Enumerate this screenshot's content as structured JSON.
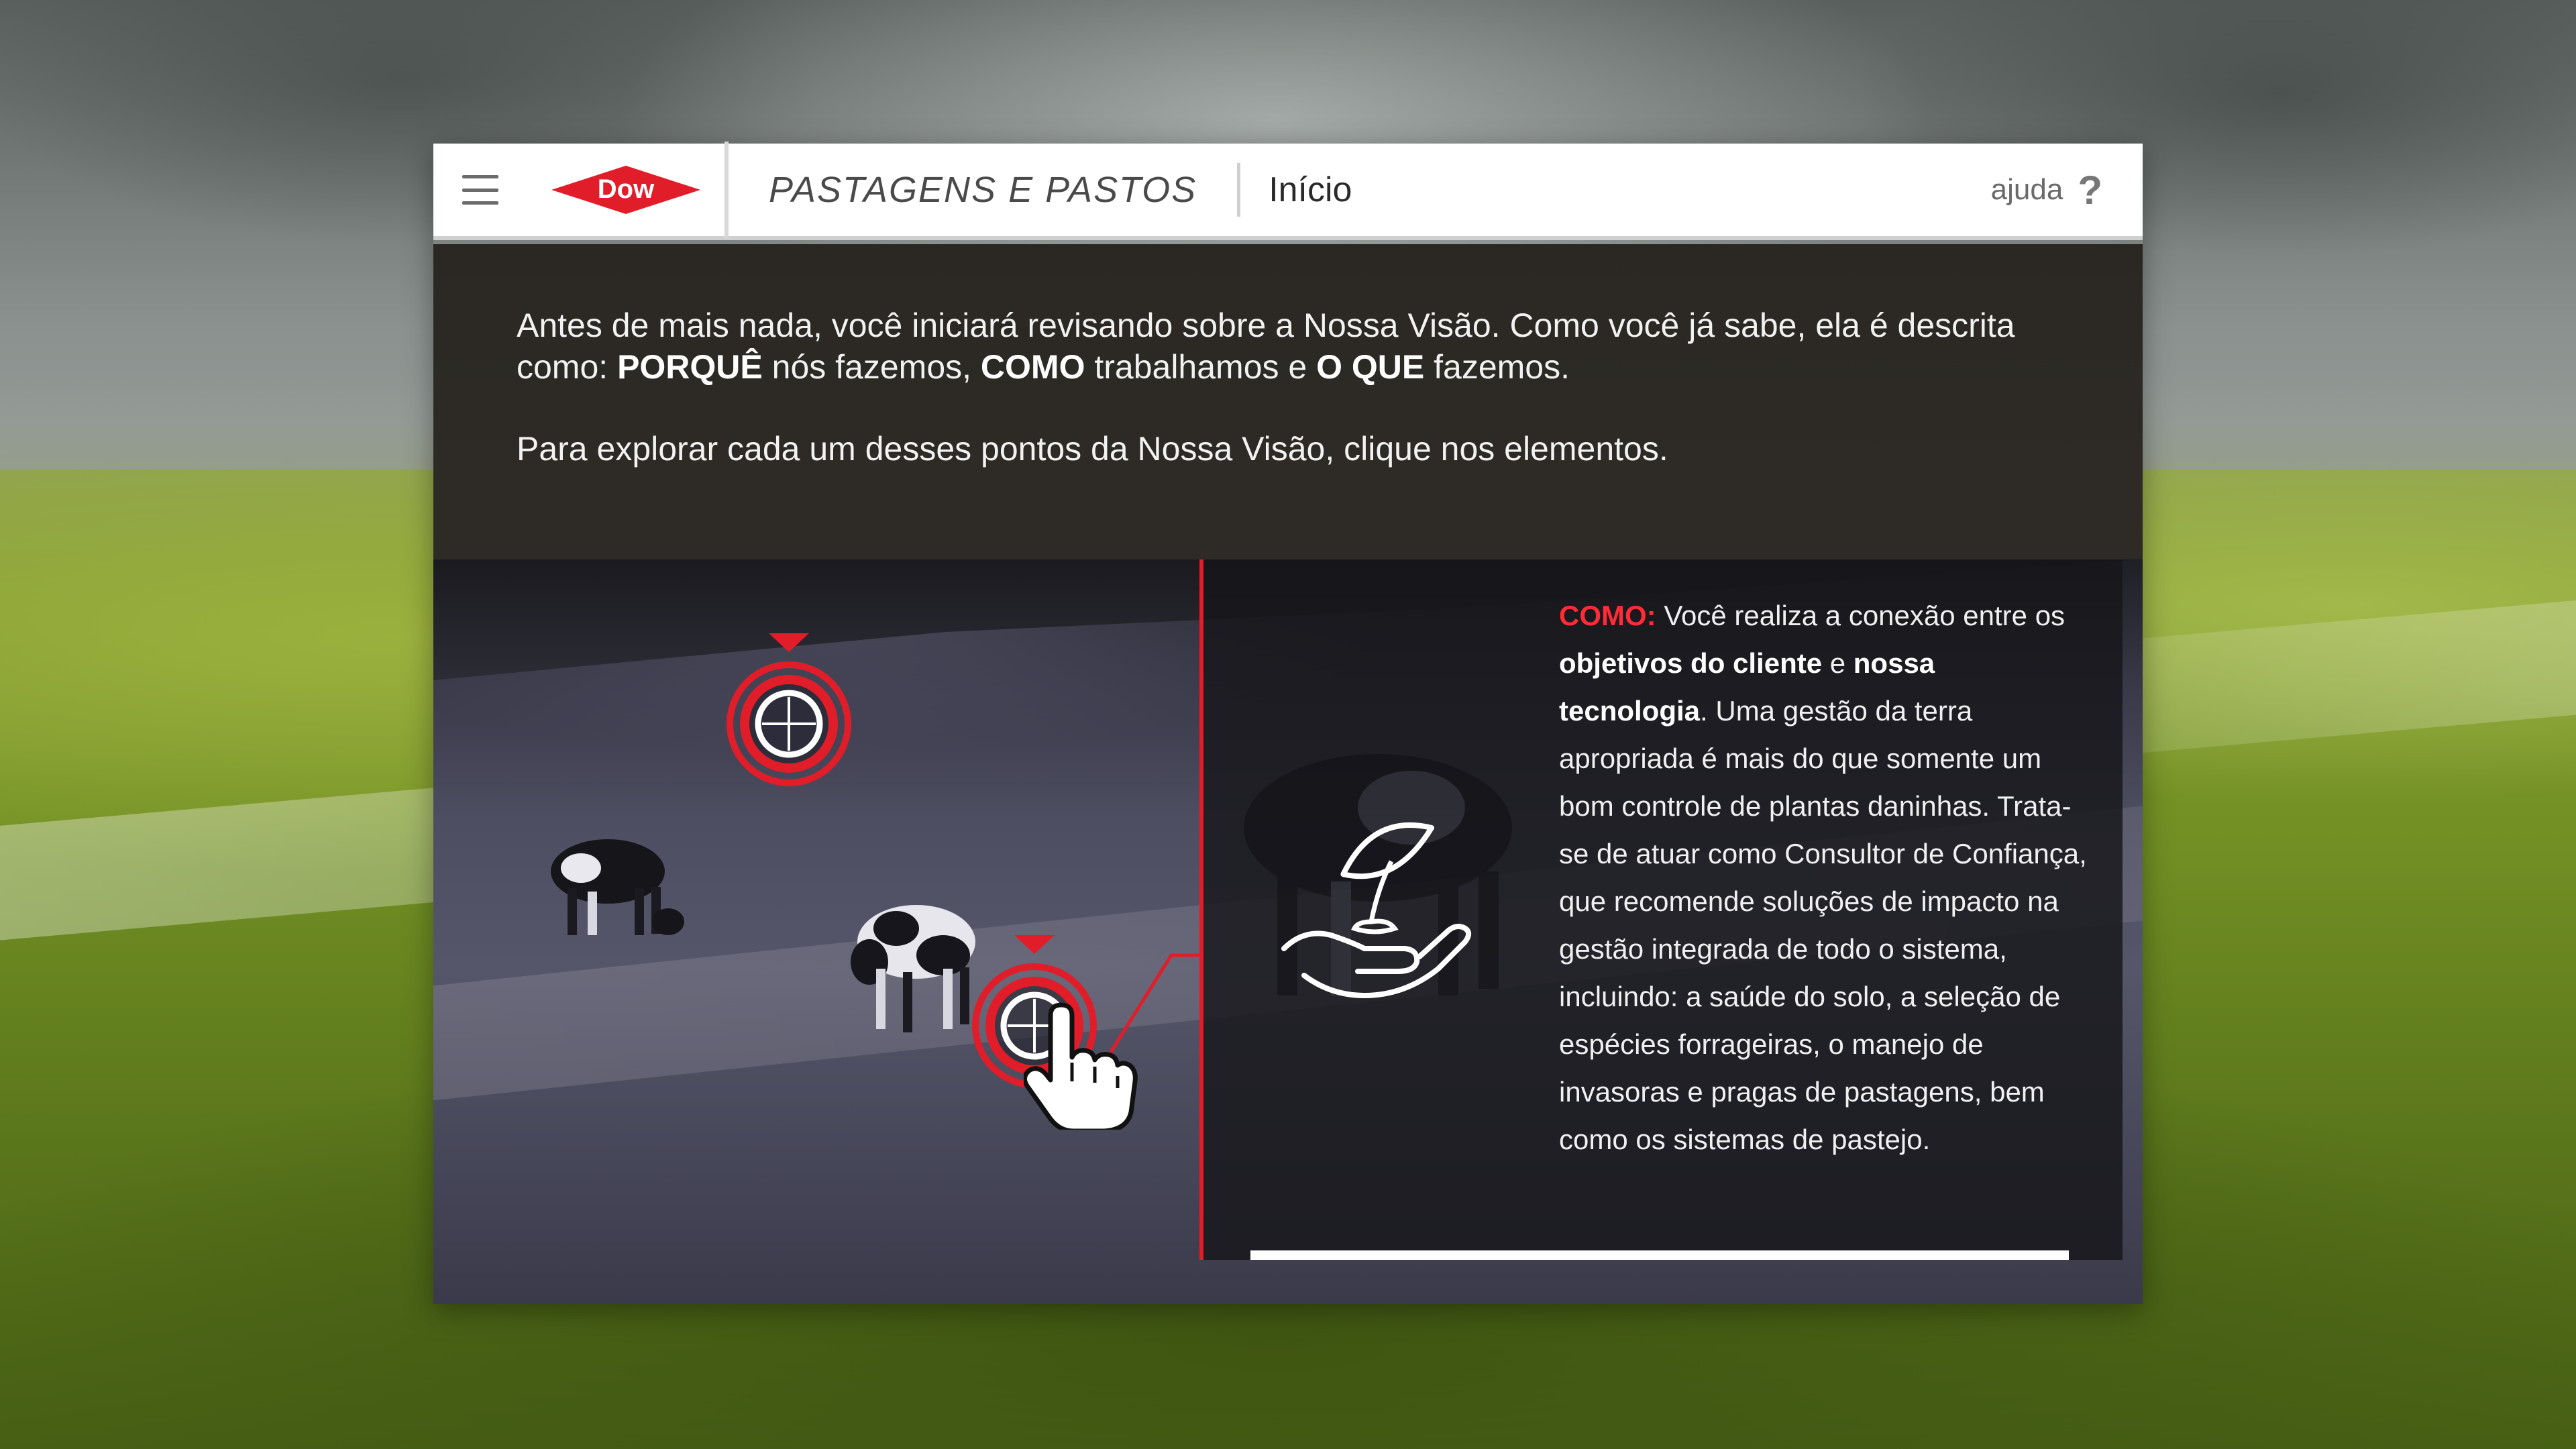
{
  "header": {
    "logo_text": "Dow",
    "section_title": "PASTAGENS E PASTOS",
    "page_title": "Início",
    "help_label": "ajuda",
    "help_icon": "?"
  },
  "intro": {
    "p1_a": "Antes de mais nada, você iniciará revisando sobre a Nossa Visão. Como você já sabe, ela é descrita como: ",
    "p1_porque": "PORQUÊ",
    "p1_b": " nós fazemos, ",
    "p1_como": "COMO",
    "p1_c": " trabalhamos e ",
    "p1_oque": "O QUE",
    "p1_d": " fazemos.",
    "p2": "Para explorar cada um desses pontos da Nossa Visão, clique nos elementos."
  },
  "info": {
    "lead": "COMO:",
    "t1": " Você realiza a conexão entre os ",
    "b1": "objetivos do cliente",
    "t2": " e ",
    "b2": "nossa tecnologia",
    "t3": ". Uma gestão da terra apropriada é mais do que somente um bom controle de plantas daninhas. Trata-se de atuar como Consultor de Confiança, que recomende soluções de impacto na gestão integrada de todo o sistema, incluindo: a saúde do solo, a seleção de espécies forrageiras, o manejo de invasoras e pragas de pastagens, bem como os sistemas de pastejo."
  },
  "colors": {
    "accent": "#e11d2a",
    "dark_bg": "#2a2824",
    "panel_bg": "#16161a"
  },
  "icons": {
    "menu": "hamburger-icon",
    "help": "question-icon",
    "hotspot": "target-icon",
    "cursor": "hand-pointer-icon",
    "plant": "plant-in-hand-icon"
  }
}
